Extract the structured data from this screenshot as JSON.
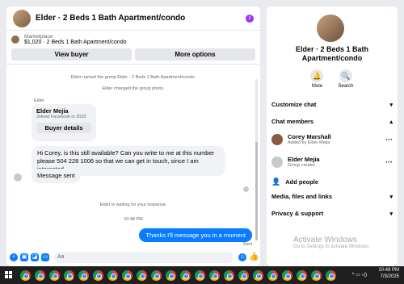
{
  "chat": {
    "title": "Elder · 2 Beds 1 Bath Apartment/condo",
    "marketplace": {
      "label": "Marketplace",
      "listing": "$1,020 · 2 Beds 1 Bath Apartment/condo",
      "view_buyer": "View buyer",
      "more_options": "More options"
    },
    "system_1": "Elder named the group Elder · 2 Beds 1 Bath Apartment/condo.",
    "system_2": "Elder changed the group photo.",
    "sender_label": "Elder",
    "card": {
      "name": "Elder Mejia",
      "sub": "Joined Facebook in 2025",
      "button": "Buyer details"
    },
    "message_1": "Hi Corey, is this still available? Can you write to me at this number please 504 228 1006 so that we can get in touch, since I am interested",
    "message_2": "Message sent",
    "waiting": "Elder is waiting for your response.",
    "time": "10:48 PM",
    "outgoing": "Thanks I'll message you in a moment",
    "sent_status": "Sent",
    "composer_placeholder": "Aa"
  },
  "details": {
    "name": "Elder · 2 Beds 1 Bath Apartment/condo",
    "mute": "Mute",
    "search": "Search",
    "customize": "Customize chat",
    "members_header": "Chat members",
    "members": [
      {
        "name": "Corey Marshall",
        "sub": "Added by Elder Mejia"
      },
      {
        "name": "Elder Mejia",
        "sub": "Group creator"
      }
    ],
    "add_people": "Add people",
    "media": "Media, files and links",
    "privacy": "Privacy & support"
  },
  "watermark": {
    "line1": "Activate Windows",
    "line2": "Go to Settings to activate Windows."
  },
  "taskbar": {
    "time": "10:48 PM",
    "date": "7/3/2025"
  },
  "colors": {
    "accent": "#0a7cff",
    "info": "#a033ff"
  }
}
